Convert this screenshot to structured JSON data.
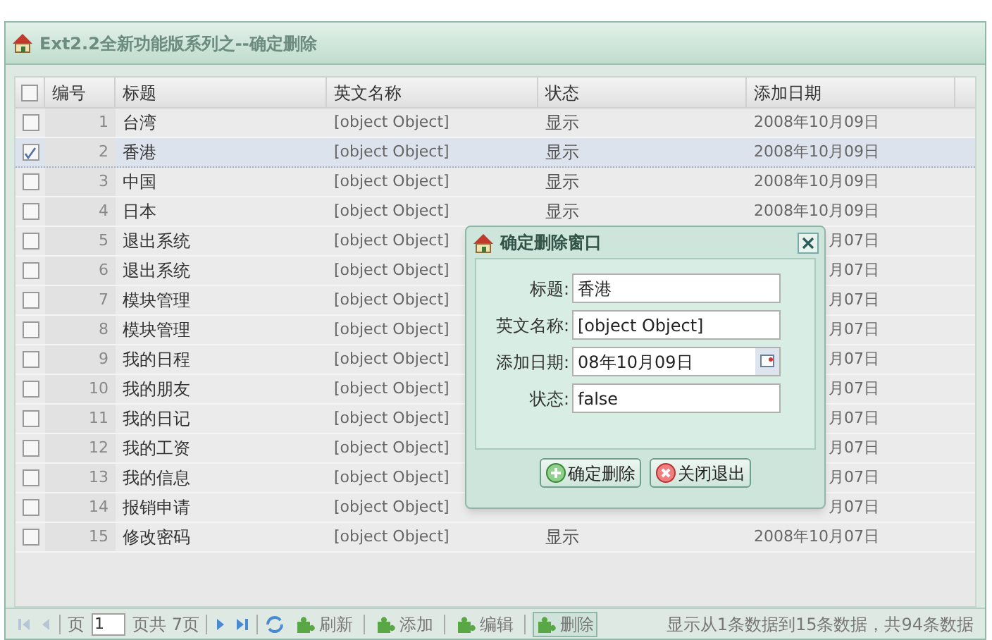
{
  "panel": {
    "title": "Ext2.2全新功能版系列之--确定删除"
  },
  "table": {
    "all_checked": false,
    "columns": [
      "编号",
      "标题",
      "英文名称",
      "状态",
      "添加日期"
    ],
    "rows": [
      {
        "number": "1",
        "title": "台湾",
        "english": "[object Object]",
        "status": "显示",
        "date": "2008年10月09日",
        "selected": false
      },
      {
        "number": "2",
        "title": "香港",
        "english": "[object Object]",
        "status": "显示",
        "date": "2008年10月09日",
        "selected": true
      },
      {
        "number": "3",
        "title": "中国",
        "english": "[object Object]",
        "status": "显示",
        "date": "2008年10月09日",
        "selected": false
      },
      {
        "number": "4",
        "title": "日本",
        "english": "[object Object]",
        "status": "显示",
        "date": "2008年10月09日",
        "selected": false
      },
      {
        "number": "5",
        "title": "退出系统",
        "english": "[object Object]",
        "date": "月07日",
        "clipped": true,
        "selected": false
      },
      {
        "number": "6",
        "title": "退出系统",
        "english": "[object Object]",
        "date": "月07日",
        "clipped": true,
        "selected": false
      },
      {
        "number": "7",
        "title": "模块管理",
        "english": "[object Object]",
        "date": "月07日",
        "clipped": true,
        "selected": false
      },
      {
        "number": "8",
        "title": "模块管理",
        "english": "[object Object]",
        "date": "月07日",
        "clipped": true,
        "selected": false
      },
      {
        "number": "9",
        "title": "我的日程",
        "english": "[object Object]",
        "date": "月07日",
        "clipped": true,
        "selected": false
      },
      {
        "number": "10",
        "title": "我的朋友",
        "english": "[object Object]",
        "date": "月07日",
        "clipped": true,
        "selected": false
      },
      {
        "number": "11",
        "title": "我的日记",
        "english": "[object Object]",
        "date": "月07日",
        "clipped": true,
        "selected": false
      },
      {
        "number": "12",
        "title": "我的工资",
        "english": "[object Object]",
        "date": "月07日",
        "clipped": true,
        "selected": false
      },
      {
        "number": "13",
        "title": "我的信息",
        "english": "[object Object]",
        "date": "月07日",
        "clipped": true,
        "selected": false
      },
      {
        "number": "14",
        "title": "报销申请",
        "english": "[object Object]",
        "date": "月07日",
        "clipped": true,
        "selected": false
      },
      {
        "number": "15",
        "title": "修改密码",
        "english": "[object Object]",
        "status": "显示",
        "date": "2008年10月07日",
        "selected": false
      }
    ]
  },
  "paging": {
    "page_label": "页",
    "page": "1",
    "page_total": "页共 7页",
    "buttons": [
      {
        "label": "刷新",
        "pressed": false
      },
      {
        "label": "添加",
        "pressed": false
      },
      {
        "label": "编辑",
        "pressed": false
      },
      {
        "label": "删除",
        "pressed": true
      }
    ],
    "info": "显示从1条数据到15条数据，共94条数据"
  },
  "dialog": {
    "title": "确定删除窗口",
    "fields": [
      {
        "label": "标题:",
        "value": "香港",
        "kind": "text"
      },
      {
        "label": "英文名称:",
        "value": "[object Object]",
        "kind": "text"
      },
      {
        "label": "添加日期:",
        "value": "08年10月09日",
        "kind": "date"
      },
      {
        "label": "状态:",
        "value": "false",
        "kind": "text"
      }
    ],
    "buttons": [
      {
        "label": "确定删除",
        "kind": "confirm"
      },
      {
        "label": "关闭退出",
        "kind": "cancel"
      }
    ]
  }
}
